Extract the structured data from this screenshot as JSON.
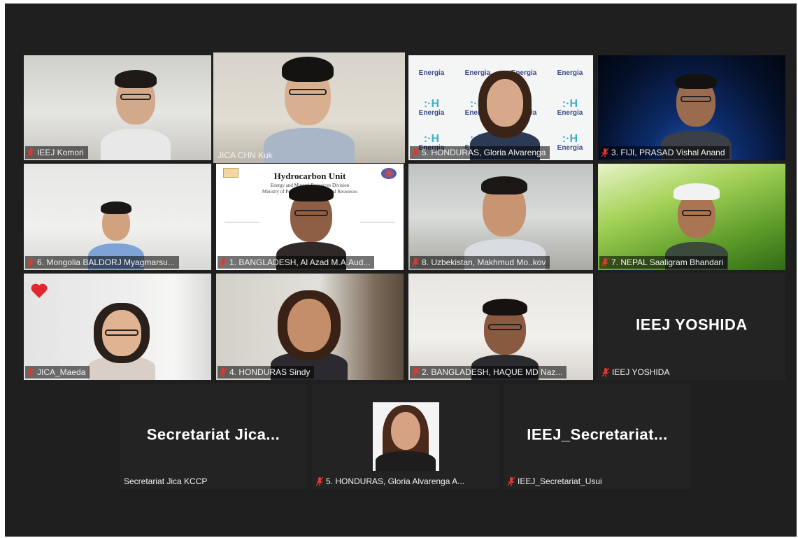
{
  "window": {
    "caption": ""
  },
  "colors": {
    "stage_bg": "#1f1f1f",
    "tile_bg": "#2a2a2a",
    "speaking_border": "#c7df3e",
    "mic_muted": "#e0392f"
  },
  "participants": [
    {
      "name": "IEEJ Komori",
      "muted": true
    },
    {
      "name": "JICA CHN Kuk",
      "muted": false,
      "speaking": true
    },
    {
      "name": "5. HONDURAS, Gloria Alvarenga",
      "muted": true
    },
    {
      "name": "3. FIJI, PRASAD Vishal Anand",
      "muted": true
    },
    {
      "name": "6. Mongolia BALDORJ Myagmarsu...",
      "muted": true
    },
    {
      "name": "1. BANGLADESH, Al Azad M.A.Aud...",
      "muted": true
    },
    {
      "name": "8. Uzbekistan, Makhmud Mo..kov",
      "muted": true
    },
    {
      "name": "7. NEPAL Saaligram Bhandari",
      "muted": true
    },
    {
      "name": "JICA_Maeda",
      "muted": true,
      "reaction": "heart"
    },
    {
      "name": "4. HONDURAS Sindy",
      "muted": true
    },
    {
      "name": "2. BANGLADESH, HAQUE MD Naz...",
      "muted": true
    },
    {
      "name": "IEEJ YOSHIDA",
      "muted": true,
      "video_off": true,
      "display_name": "IEEJ YOSHIDA"
    },
    {
      "name": "Secretariat Jica KCCP",
      "muted": false,
      "video_off": true,
      "display_name": "Secretariat  Jica..."
    },
    {
      "name": "5. HONDURAS, Gloria Alvarenga A...",
      "muted": true,
      "video_off": true,
      "profile_photo": true
    },
    {
      "name": "IEEJ_Secretariat_Usui",
      "muted": true,
      "video_off": true,
      "display_name": "IEEJ_Secretariat..."
    }
  ],
  "energia_tile": {
    "logo_word": "Energia",
    "logo_mark": ":·H"
  },
  "slide": {
    "title": "Hydrocarbon Unit",
    "subtitle_line1": "Energy and Mineral Resources Division",
    "subtitle_line2": "Ministry of Power, Energy & Mineral Resources"
  }
}
